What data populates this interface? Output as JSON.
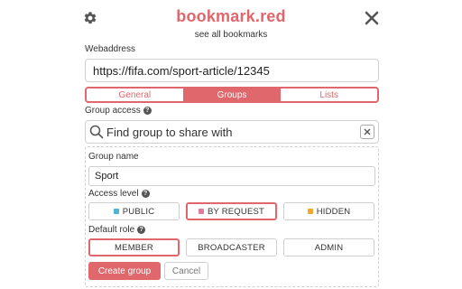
{
  "header": {
    "title": "bookmark.red",
    "subtitle": "see all bookmarks",
    "settings_icon": "gear-icon",
    "close_icon": "close-icon"
  },
  "webaddress": {
    "label": "Webaddress",
    "value": "https://fifa.com/sport-article/12345"
  },
  "tabs": [
    {
      "label": "General",
      "active": false
    },
    {
      "label": "Groups",
      "active": true
    },
    {
      "label": "Lists",
      "active": false
    }
  ],
  "group_access": {
    "label": "Group access",
    "search_placeholder": "Find group to share with"
  },
  "group_form": {
    "name_label": "Group name",
    "name_value": "Sport",
    "access_label": "Access level",
    "access_options": [
      {
        "label": "PUBLIC",
        "color": "#4db6d4",
        "selected": false
      },
      {
        "label": "BY REQUEST",
        "color": "#e07b9b",
        "selected": true
      },
      {
        "label": "HIDDEN",
        "color": "#f0a830",
        "selected": false
      }
    ],
    "role_label": "Default role",
    "role_options": [
      {
        "label": "MEMBER",
        "selected": true
      },
      {
        "label": "BROADCASTER",
        "selected": false
      },
      {
        "label": "ADMIN",
        "selected": false
      }
    ],
    "create_label": "Create group",
    "cancel_label": "Cancel"
  },
  "colors": {
    "accent": "#e0676c"
  }
}
